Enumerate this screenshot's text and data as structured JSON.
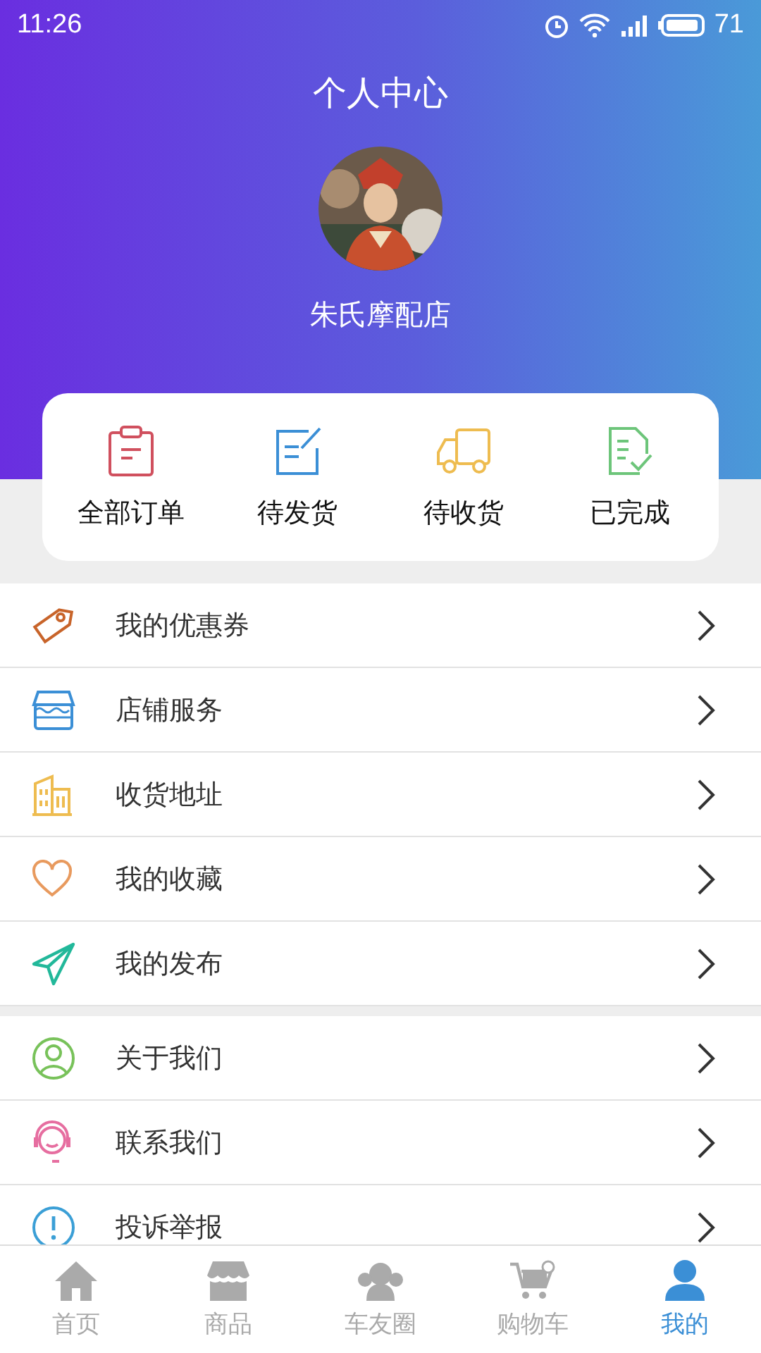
{
  "status_bar": {
    "time": "11:26",
    "battery": "71"
  },
  "header": {
    "title": "个人中心",
    "shop_name": "朱氏摩配店"
  },
  "orders": [
    {
      "label": "全部订单"
    },
    {
      "label": "待发货"
    },
    {
      "label": "待收货"
    },
    {
      "label": "已完成"
    }
  ],
  "menu_groups": [
    [
      {
        "label": "我的优惠券"
      },
      {
        "label": "店铺服务"
      },
      {
        "label": "收货地址"
      },
      {
        "label": "我的收藏"
      },
      {
        "label": "我的发布"
      }
    ],
    [
      {
        "label": "关于我们"
      },
      {
        "label": "联系我们"
      },
      {
        "label": "投诉举报"
      }
    ]
  ],
  "tab_bar": [
    {
      "label": "首页",
      "selected": false
    },
    {
      "label": "商品",
      "selected": false
    },
    {
      "label": "车友圈",
      "selected": false
    },
    {
      "label": "购物车",
      "selected": false
    },
    {
      "label": "我的",
      "selected": true
    }
  ]
}
